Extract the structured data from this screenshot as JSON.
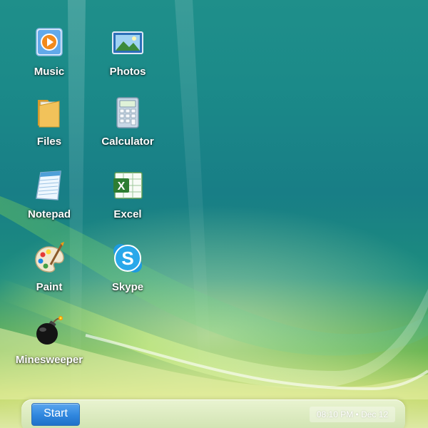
{
  "desktop": {
    "icons": [
      {
        "label": "Music",
        "icon": "music-player-icon"
      },
      {
        "label": "Photos",
        "icon": "photos-icon"
      },
      {
        "label": "Files",
        "icon": "folder-icon"
      },
      {
        "label": "Calculator",
        "icon": "calculator-icon"
      },
      {
        "label": "Notepad",
        "icon": "notepad-icon"
      },
      {
        "label": "Excel",
        "icon": "excel-icon"
      },
      {
        "label": "Paint",
        "icon": "paint-palette-icon"
      },
      {
        "label": "Skype",
        "icon": "skype-icon"
      },
      {
        "label": "Minesweeper",
        "icon": "bomb-icon"
      }
    ]
  },
  "taskbar": {
    "start_label": "Start",
    "clock": "08:10 PM • Dec 12"
  },
  "colors": {
    "start_button": "#2f86de",
    "wallpaper_top": "#1f8f8a",
    "wallpaper_bottom": "#dde9a4"
  }
}
